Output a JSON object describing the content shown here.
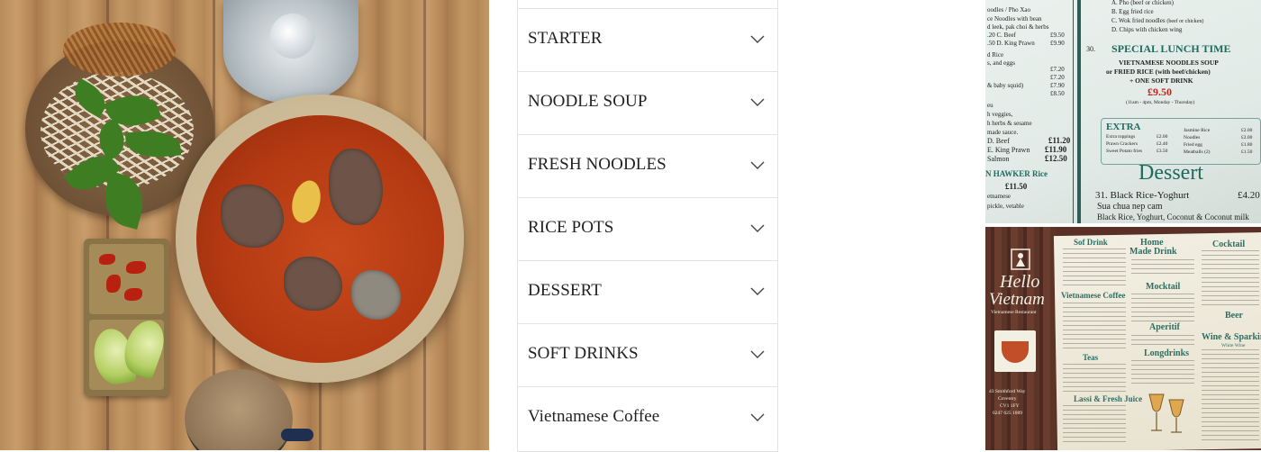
{
  "accordion": {
    "items": [
      {
        "label": ""
      },
      {
        "label": "STARTER"
      },
      {
        "label": "NOODLE SOUP"
      },
      {
        "label": "FRESH NOODLES"
      },
      {
        "label": "RICE POTS"
      },
      {
        "label": "DESSERT"
      },
      {
        "label": "SOFT DRINKS"
      },
      {
        "label": "Vietnamese Coffee"
      },
      {
        "label": ""
      }
    ],
    "chevron_icon": "chevron-down-icon",
    "label_prefix_glyph": "",
    "colors": {
      "text": "#222222",
      "border": "#e3e3e3",
      "chevron": "#444444"
    }
  },
  "menu_photo_top": {
    "lines": {
      "a": "A. Pho (beef or chicken)",
      "b": "B. Egg fried rice",
      "c": "C. Wok fried noodles",
      "c_note": "(beef or chicken)",
      "d": "D. Chips with chicken wing",
      "l1": "oodles / Pho Xao",
      "l2": "ce Noodles with bean",
      "l3": "d leek, pak choi & herbs",
      "p1": ".20   C. Beef",
      "p1v": "£9.50",
      "p2": ".50   D. King Prawn",
      "p2v": "£9.90",
      "l4": "d Rice",
      "l5": "s, and eggs",
      "q1": "£7.20",
      "q2": "£7.20",
      "q3": "& baby squid)",
      "q3v": "£7.90",
      "q4": "£8.50",
      "l6": "eu",
      "l7": "h veggies,",
      "l8": "h herbs & sesame",
      "l9": "made sauce.",
      "r1": "D. Beef",
      "r1v": "£11.20",
      "r2": "E. King Prawn",
      "r2v": "£11.90",
      "r3": "Salmon",
      "r3v": "£12.50",
      "hawker": "N HAWKER Rice",
      "hawker_price": "£11.50",
      "l10": "etnamese",
      "l11": "pickle, vetable",
      "num30": "30.",
      "special_title": "SPECIAL LUNCH TIME",
      "special_1": "VIETNAMESE NOODLES SOUP",
      "special_2": "or FRIED RICE (with beef/chicken)",
      "special_3": "+ ONE SOFT DRINK",
      "special_price": "£9.50",
      "special_hours": "(11am - 4pm, Monday - Thursday)",
      "extra_title": "EXTRA",
      "extra_col1": [
        "Extra toppings",
        "Prawn Crackers",
        "Sweet Potato fries"
      ],
      "extra_col1_prices": [
        "£2.00",
        "£2.40",
        "£3.50"
      ],
      "extra_col2": [
        "Jasmine Rice",
        "Noodles",
        "Fried egg",
        "Meatballs (2)"
      ],
      "extra_col2_prices": [
        "£2.00",
        "£2.00",
        "£1.80",
        "£1.50"
      ],
      "dessert_title": "Dessert",
      "dessert_item": "31. Black Rice-Yoghurt",
      "dessert_price": "£4.20",
      "dessert_sub": "Sua chua nep cam",
      "dessert_desc": "Black Rice, Yoghurt, Coconut & Coconut milk"
    }
  },
  "menu_photo_bottom": {
    "brand_1": "Hello",
    "brand_2": "Vietnam",
    "brand_sub": "Vietnamese Restaurant",
    "address": [
      "43 Smithford Way",
      "Coventry",
      "CV1 1FY",
      "0247 625 1889"
    ],
    "headings": {
      "soft_drink": "Sof Drink",
      "home_made": "Home",
      "home_made_2": "Made Drink",
      "cocktail": "Cocktail",
      "mocktail": "Mocktail",
      "viet_coffee": "Vietnamese Coffee",
      "beer": "Beer",
      "aperitif": "Aperitif",
      "wine": "Wine & Sparkin",
      "white_wine": "White Wine",
      "teas": "Teas",
      "longdrinks": "Longdrinks",
      "lassi": "Lassi & Fresh Juice"
    }
  }
}
